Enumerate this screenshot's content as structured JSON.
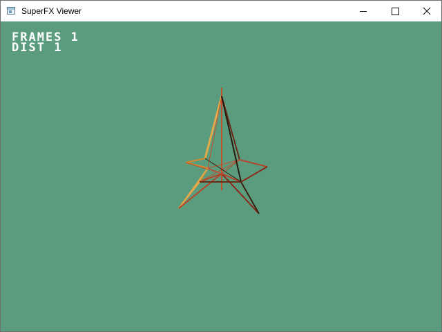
{
  "window": {
    "title": "SuperFX Viewer",
    "icon": "app-window-icon"
  },
  "controls": {
    "minimize_icon": "minimize-icon",
    "maximize_icon": "maximize-icon",
    "close_icon": "close-icon"
  },
  "hud": {
    "frames_label": "FRAMES",
    "frames_value": "1",
    "dist_label": "DIST",
    "dist_value": "1"
  },
  "colors": {
    "background": "#5b9c7e",
    "hud_text": "#ffffff",
    "edge_orange": "#d88a2a",
    "edge_red": "#b5452a",
    "edge_dark": "#3b1f10",
    "edge_light": "#e2a84a"
  }
}
